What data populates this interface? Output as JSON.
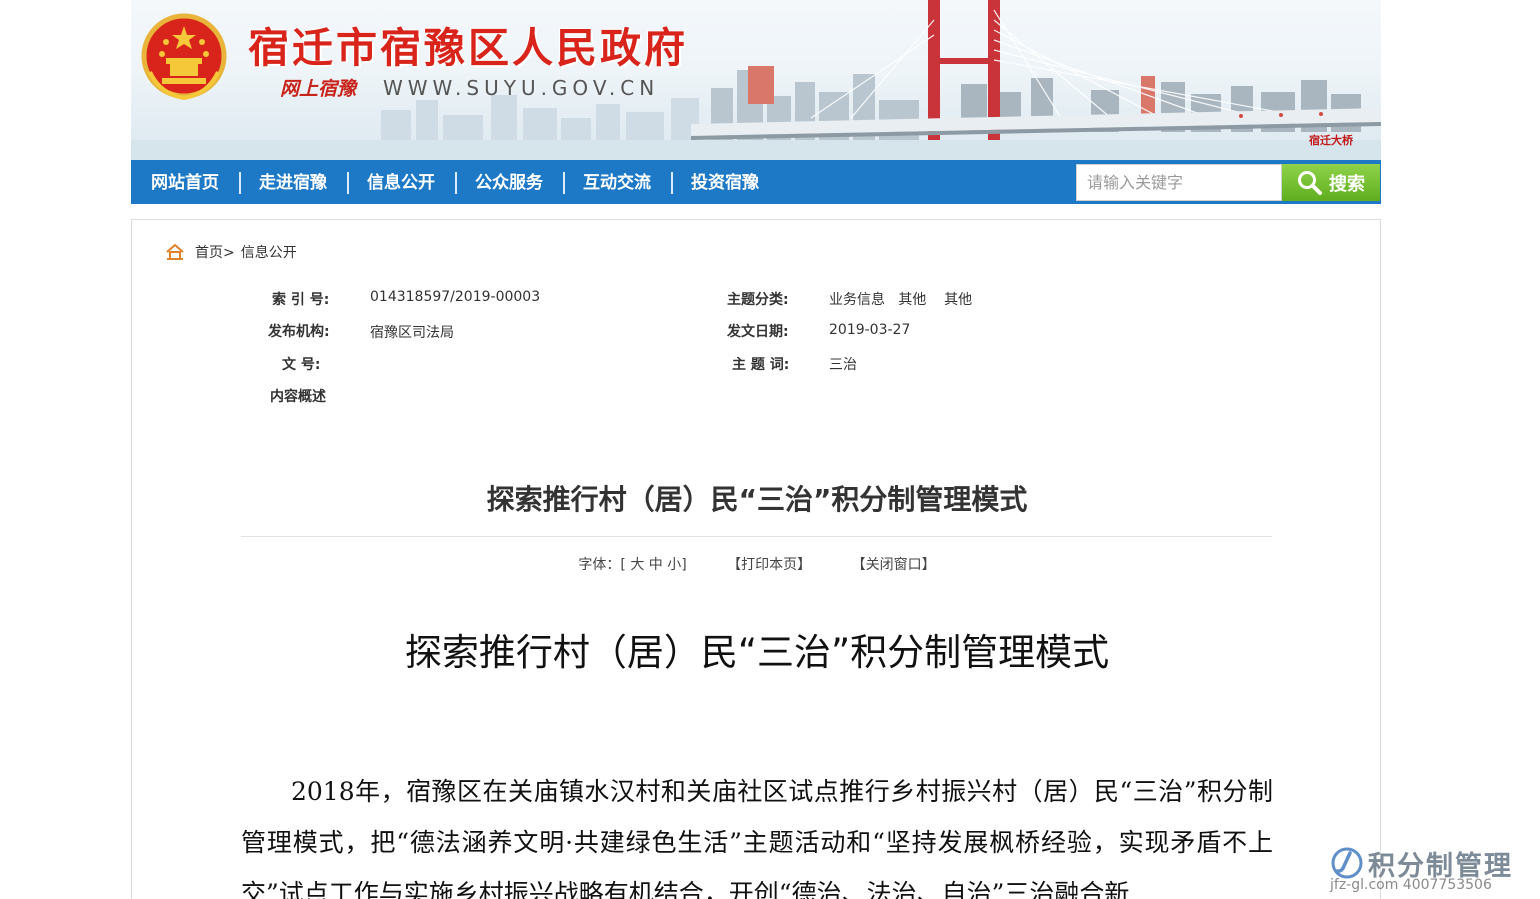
{
  "header": {
    "title": "宿迁市宿豫区人民政府",
    "slogan": "网上宿豫",
    "url": "WWW.SUYU.GOV.CN",
    "bridge_label": "宿迁大桥",
    "accent_color": "#d8241b"
  },
  "nav": {
    "items": [
      {
        "label": "网站首页"
      },
      {
        "label": "走进宿豫"
      },
      {
        "label": "信息公开"
      },
      {
        "label": "公众服务"
      },
      {
        "label": "互动交流"
      },
      {
        "label": "投资宿豫"
      }
    ],
    "search_placeholder": "请输入关键字",
    "search_button": "搜索",
    "bar_color": "#1d79c6"
  },
  "breadcrumb": {
    "home": "首页>",
    "current": "信息公开"
  },
  "meta": {
    "index_label": "索 引 号:",
    "index_value": "014318597/2019-00003",
    "category_label": "主题分类:",
    "category_value": "业务信息   其他    其他",
    "publisher_label": "发布机构:",
    "publisher_value": "宿豫区司法局",
    "date_label": "发文日期:",
    "date_value": "2019-03-27",
    "docno_label": "文 号:",
    "docno_value": "",
    "keyword_label": "主 题 词:",
    "keyword_value": "三治",
    "summary_label": "内容概述"
  },
  "document": {
    "title": "探索推行村（居）民“三治”积分制管理模式",
    "font_size": "字体：[ 大 中 小]",
    "print": "【打印本页】",
    "close": "【关闭窗口】",
    "heading": "探索推行村（居）民“三治”积分制管理模式",
    "body": "2018年，宿豫区在关庙镇水汉村和关庙社区试点推行乡村振兴村（居）民“三治”积分制管理模式，把“德法涵养文明·共建绿色生活”主题活动和“坚持发展枫桥经验，实现矛盾不上交”试点工作与实施乡村振兴战略有机结合，开创“德治、法治、自治”三治融合新"
  },
  "watermark": {
    "text": "积分制管理",
    "contact": "jfz-gl.com 4007753506"
  }
}
